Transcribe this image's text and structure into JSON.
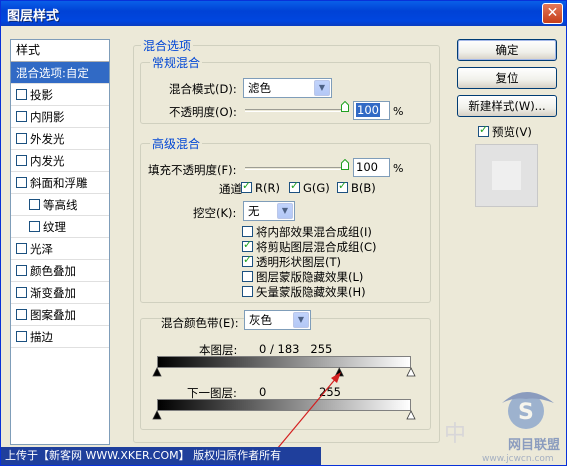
{
  "window": {
    "title": "图层样式",
    "close_glyph": "✕"
  },
  "styles_panel": {
    "header": "样式",
    "items": [
      {
        "label": "混合选项:自定",
        "checkbox": false,
        "checked": false,
        "selected": true,
        "indent": false
      },
      {
        "label": "投影",
        "checkbox": true,
        "checked": false,
        "selected": false,
        "indent": false
      },
      {
        "label": "内阴影",
        "checkbox": true,
        "checked": false,
        "selected": false,
        "indent": false
      },
      {
        "label": "外发光",
        "checkbox": true,
        "checked": false,
        "selected": false,
        "indent": false
      },
      {
        "label": "内发光",
        "checkbox": true,
        "checked": false,
        "selected": false,
        "indent": false
      },
      {
        "label": "斜面和浮雕",
        "checkbox": true,
        "checked": false,
        "selected": false,
        "indent": false
      },
      {
        "label": "等高线",
        "checkbox": true,
        "checked": false,
        "selected": false,
        "indent": true
      },
      {
        "label": "纹理",
        "checkbox": true,
        "checked": false,
        "selected": false,
        "indent": true
      },
      {
        "label": "光泽",
        "checkbox": true,
        "checked": false,
        "selected": false,
        "indent": false
      },
      {
        "label": "颜色叠加",
        "checkbox": true,
        "checked": false,
        "selected": false,
        "indent": false
      },
      {
        "label": "渐变叠加",
        "checkbox": true,
        "checked": false,
        "selected": false,
        "indent": false
      },
      {
        "label": "图案叠加",
        "checkbox": true,
        "checked": false,
        "selected": false,
        "indent": false
      },
      {
        "label": "描边",
        "checkbox": true,
        "checked": false,
        "selected": false,
        "indent": false
      }
    ]
  },
  "blend_options": {
    "title": "混合选项",
    "general": {
      "title": "常规混合",
      "mode_label": "混合模式(D):",
      "mode_value": "滤色",
      "opacity_label": "不透明度(O):",
      "opacity_value": "100",
      "opacity_unit": "%",
      "opacity_level": 1.0
    },
    "advanced": {
      "title": "高级混合",
      "fill_label": "填充不透明度(F):",
      "fill_value": "100",
      "fill_unit": "%",
      "fill_level": 1.0,
      "channels_label": "通道:",
      "channels": [
        {
          "label": "R(R)",
          "checked": true
        },
        {
          "label": "G(G)",
          "checked": true
        },
        {
          "label": "B(B)",
          "checked": true
        }
      ],
      "knockout_label": "挖空(K):",
      "knockout_value": "无",
      "options": [
        {
          "label": "将内部效果混合成组(I)",
          "checked": false
        },
        {
          "label": "将剪贴图层混合成组(C)",
          "checked": true
        },
        {
          "label": "透明形状图层(T)",
          "checked": true
        },
        {
          "label": "图层蒙版隐藏效果(L)",
          "checked": false
        },
        {
          "label": "矢量蒙版隐藏效果(H)",
          "checked": false
        }
      ]
    },
    "blend_if": {
      "label": "混合颜色带(E):",
      "value": "灰色",
      "this_layer_label": "本图层:",
      "this_layer_values": "0 / 183   255",
      "this_layer_black_split": [
        0,
        183
      ],
      "this_layer_white": 255,
      "underlying_label": "下一图层:",
      "underlying_black": "0",
      "underlying_white": "255",
      "underlying_black_value": 0,
      "underlying_white_value": 255
    }
  },
  "buttons": {
    "ok": "确定",
    "reset": "复位",
    "new_style": "新建样式(W)...",
    "preview_label": "预览(V)",
    "preview_checked": true
  },
  "status": {
    "text": "上传于【新客网 WWW.XKER.COM】 版权归原作者所有"
  },
  "watermark": {
    "text_cn": "中",
    "text_site": "www.jcwcn.com",
    "brand": "网目联盟"
  },
  "colors": {
    "title_bar": "#0A5FE8",
    "selection": "#316AC5",
    "group_title": "#0046D5",
    "arrow": "#D42020"
  }
}
